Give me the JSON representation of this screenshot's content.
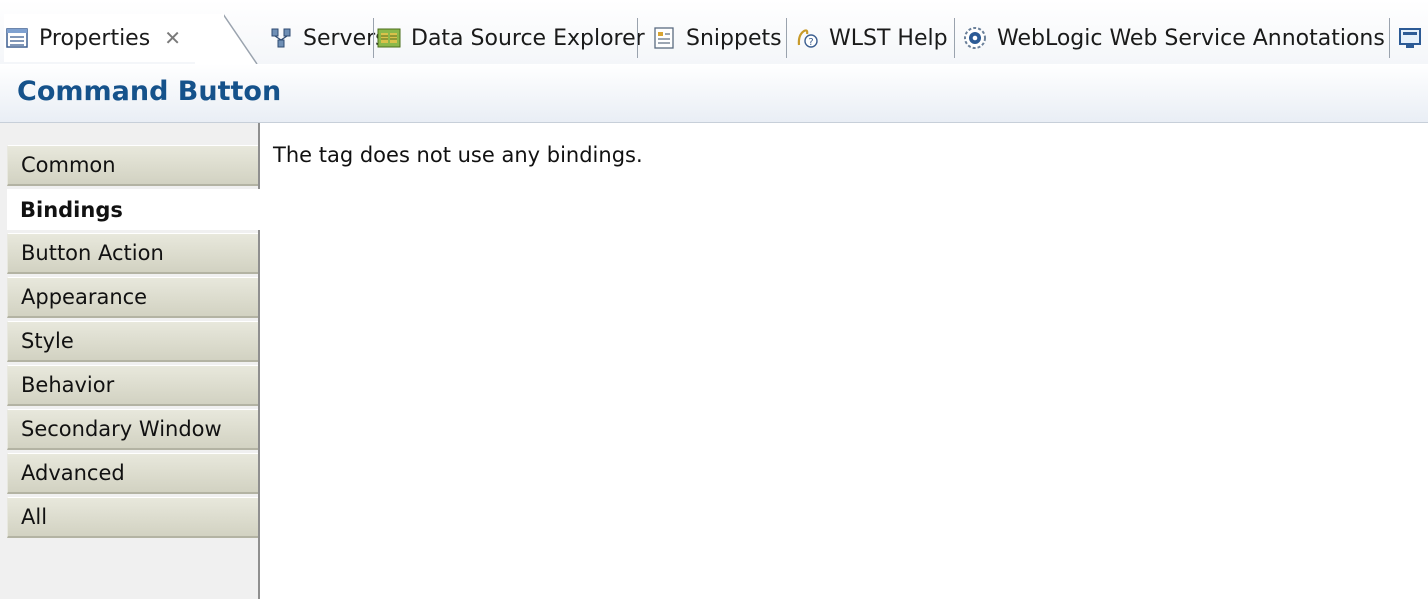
{
  "tabs": [
    {
      "label": "Properties",
      "icon": "properties-icon",
      "active": true,
      "close": "✕"
    },
    {
      "label": "Servers",
      "icon": "servers-icon"
    },
    {
      "label": "Data Source Explorer",
      "icon": "data-source-explorer-icon"
    },
    {
      "label": "Snippets",
      "icon": "snippets-icon"
    },
    {
      "label": "WLST Help",
      "icon": "wlst-help-icon"
    },
    {
      "label": "WebLogic Web Service Annotations",
      "icon": "weblogic-annotations-icon"
    },
    {
      "label": "",
      "icon": "overflow-view-icon"
    }
  ],
  "header": {
    "title": "Command Button"
  },
  "nav": {
    "items": [
      {
        "label": "Common"
      },
      {
        "label": "Bindings",
        "selected": true
      },
      {
        "label": "Button Action"
      },
      {
        "label": "Appearance"
      },
      {
        "label": "Style"
      },
      {
        "label": "Behavior"
      },
      {
        "label": "Secondary Window"
      },
      {
        "label": "Advanced"
      },
      {
        "label": "All"
      }
    ]
  },
  "content": {
    "message": "The tag does not use any bindings."
  },
  "colors": {
    "title": "#15528b",
    "tab_bar_border": "#b4bcc8",
    "nav_item_bg": "#d2d2c2"
  }
}
